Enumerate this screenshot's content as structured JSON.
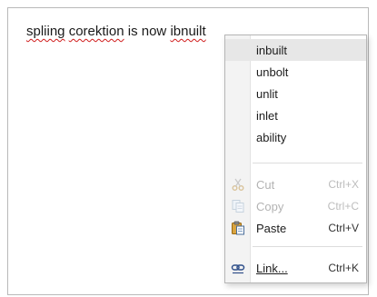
{
  "editor": {
    "words": [
      {
        "text": "spliing",
        "misspelled": true
      },
      {
        "text": " "
      },
      {
        "text": "corektion",
        "misspelled": true
      },
      {
        "text": " is now "
      },
      {
        "text": "ibnuilt",
        "misspelled": true
      }
    ]
  },
  "context_menu": {
    "suggestions": [
      "inbuilt",
      "unbolt",
      "unlit",
      "inlet",
      "ability"
    ],
    "cut": {
      "label": "Cut",
      "shortcut": "Ctrl+X",
      "icon": "scissors-icon",
      "enabled": false
    },
    "copy": {
      "label": "Copy",
      "shortcut": "Ctrl+C",
      "icon": "copy-icon",
      "enabled": false
    },
    "paste": {
      "label": "Paste",
      "shortcut": "Ctrl+V",
      "icon": "paste-icon",
      "enabled": true
    },
    "link": {
      "label": "Link...",
      "shortcut": "Ctrl+K",
      "icon": "link-icon",
      "enabled": true
    }
  }
}
